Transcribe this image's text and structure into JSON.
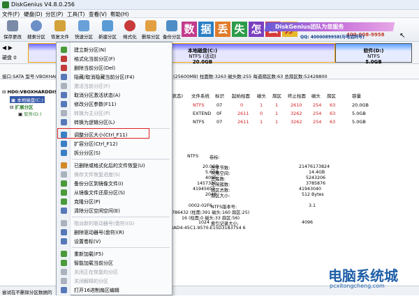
{
  "window": {
    "title": "DiskGenius V4.8.0.256"
  },
  "menu": [
    "文件(F)",
    "硬盘(D)",
    "分区(P)",
    "工具(T)",
    "查看(V)",
    "帮助(H)"
  ],
  "toolbar": [
    "保存更改",
    "搜索分区",
    "恢复文件",
    "快速分区",
    "新建分区",
    "格式化",
    "删除分区",
    "备份分区"
  ],
  "banner": {
    "tiles": [
      "数",
      "据",
      "丢",
      "失",
      "怎",
      "么",
      "办"
    ],
    "strip": "DiskGenius团队为您服务",
    "phone": "400-008-9958",
    "qq": "QQ: 4000089958(与电话同号)"
  },
  "diskbar": {
    "label": "硬盘 0",
    "partitions": [
      {
        "name": "本地磁盘(C:)",
        "fs": "NTFS (活动)",
        "size": "20.0GB"
      },
      {
        "name": "软件(D:)",
        "fs": "NTFS",
        "size": "5.0GB"
      }
    ]
  },
  "infoline": {
    "text": "接口:SATA  型号:VBOXHARDDISK",
    "right": "(25600MB)  柱面数:3263  磁头数:255  每道扇区数:63  总扇区数:52428800"
  },
  "tree": {
    "disk": "HD0:VBOXHARDDISK",
    "c": "本地磁盘(C:)",
    "ext": "扩展分区",
    "d": "软件(D:)"
  },
  "grid": {
    "headers": [
      "(状态)",
      "文件系统",
      "标识",
      "起始柱面",
      "磁头",
      "扇区",
      "终止柱面",
      "磁头",
      "扇区",
      "容量"
    ],
    "rows": [
      [
        "",
        "NTFS",
        "07",
        "0",
        "1",
        "1",
        "2610",
        "254",
        "63",
        "20.0GB"
      ],
      [
        "",
        "EXTEND",
        "0F",
        "2611",
        "0",
        "1",
        "3262",
        "254",
        "63",
        "5.0GB"
      ],
      [
        "",
        "NTFS",
        "07",
        "2611",
        "1",
        "1",
        "3262",
        "254",
        "63",
        "5.0GB"
      ]
    ]
  },
  "details": {
    "fs": "NTFS",
    "volLabel": "卷标:",
    "l1": [
      [
        "20.0GB",
        "总字节数:",
        "21476173824"
      ],
      [
        "5.6GB",
        "可用空间:",
        "14.4GB"
      ],
      [
        "4096",
        "总簇数:",
        "5243206"
      ],
      [
        "1457330",
        "空闲簇数:",
        "3785876"
      ],
      [
        "41945652",
        "扇区总数:",
        "41943040"
      ],
      [
        "2048",
        "扇区大小:",
        "512 Bytes"
      ]
    ],
    "guid": "0002-02F6",
    "ntfsver": "NTFS版本号:",
    "ntfsverval": "3.1",
    "mft": "786432 (柱面:391 磁头:160 扇区:25)",
    "mft2": "16 (柱面:0 磁头:33 扇区:56)",
    "idx": "1024",
    "idxlabel": "索引记录大小:",
    "idxval": "4096",
    "guidfull": "-BAD4-45C1-9570-E15D3183754 6"
  },
  "status": "就绪",
  "statusLeft": "尝试在不删除分区数据的",
  "context_menu": [
    {
      "label": "建立新分区(N)",
      "dis": false,
      "c": "#4a9a3a"
    },
    {
      "label": "格式化当前分区(F)",
      "dis": false,
      "c": "#c23a3a"
    },
    {
      "label": "删除当前分区(Del)",
      "dis": false,
      "c": "#c23a3a"
    },
    {
      "label": "隐藏/取消隐藏当前分区(F4)",
      "dis": false,
      "c": "#5678b8"
    },
    {
      "label": "激活当前分区(F)",
      "dis": true,
      "c": "#aab3bd"
    },
    {
      "label": "取消分区激活状态(A)",
      "dis": false,
      "c": "#5678b8"
    },
    {
      "label": "修改分区参数(F11)",
      "dis": false,
      "c": "#5678b8"
    },
    {
      "label": "转换为主分区(P)",
      "dis": true,
      "c": "#aab3bd"
    },
    {
      "label": "转换为逻辑分区(L)",
      "dis": false,
      "c": "#5678b8"
    },
    {
      "sep": true
    },
    {
      "label": "调整分区大小(Ctrl_F11)",
      "dis": false,
      "c": "#3a7fc4"
    },
    {
      "label": "扩容分区(Ctrl_F12)",
      "dis": false,
      "c": "#3a7fc4"
    },
    {
      "label": "拆分分区(S)",
      "dis": false,
      "c": "#3a7fc4"
    },
    {
      "sep": true
    },
    {
      "label": "已删除或格式化后的文件恢复(U)",
      "dis": false,
      "c": "#d08a2a"
    },
    {
      "label": "保存文件恢复进度(S)",
      "dis": true,
      "c": "#aab3bd"
    },
    {
      "label": "备份分区到镜像文件(I)",
      "dis": false,
      "c": "#4a9a3a"
    },
    {
      "label": "从镜像文件还原分区(S)",
      "dis": false,
      "c": "#4a9a3a"
    },
    {
      "label": "克隆分区(P)",
      "dis": false,
      "c": "#4a9a3a"
    },
    {
      "label": "清除分区空闲空间(E)",
      "dis": false,
      "c": "#5678b8"
    },
    {
      "sep": true
    },
    {
      "label": "指派新的驱动器号(盘符)(G)",
      "dis": true,
      "c": "#aab3bd"
    },
    {
      "label": "删除驱动器号(盘符)(R)",
      "dis": false,
      "c": "#5678b8"
    },
    {
      "label": "设置卷标(V)",
      "dis": false,
      "c": "#5678b8"
    },
    {
      "sep": true
    },
    {
      "label": "重新加载(F5)",
      "dis": false,
      "c": "#4a9a3a"
    },
    {
      "label": "智能加载当前分区",
      "dis": false,
      "c": "#4a9a3a"
    },
    {
      "label": "关闭正在恢复的分区",
      "dis": true,
      "c": "#aab3bd"
    },
    {
      "label": "关闭解释的分区",
      "dis": true,
      "c": "#aab3bd"
    },
    {
      "label": "打开16进制扇区编辑",
      "dis": false,
      "c": "#5678b8"
    }
  ],
  "watermark": {
    "line1": "电脑系统城",
    "line2": "pcxitongcheng.com"
  },
  "colors": {
    "partC": "#e6e6ff",
    "partD": "#e6ecff",
    "highlight": "#e02020"
  }
}
